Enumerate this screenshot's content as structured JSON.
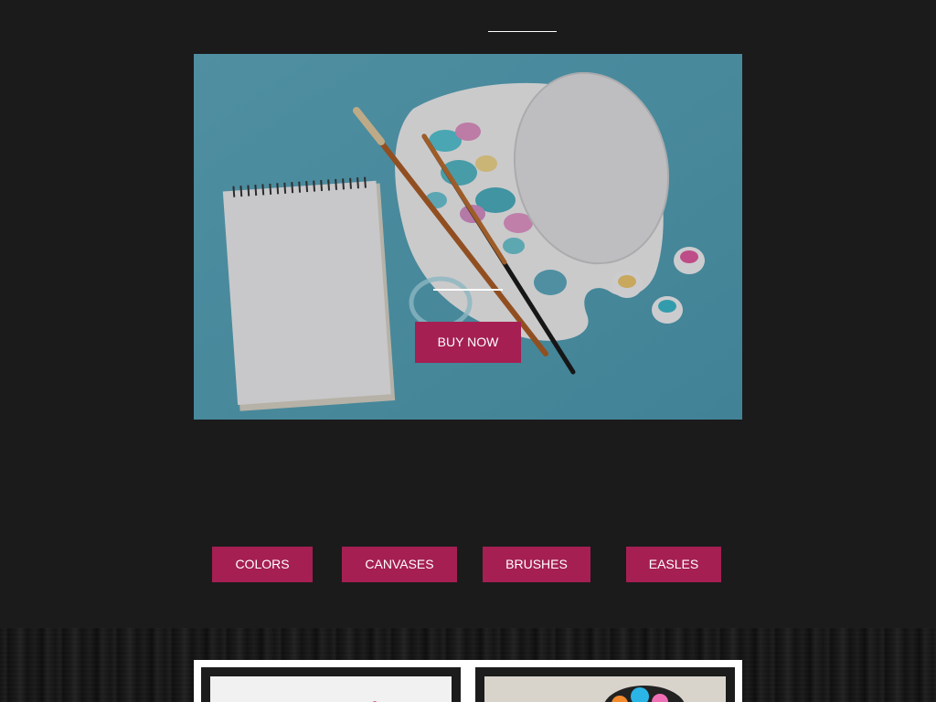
{
  "hero": {
    "buy_label": "BUY NOW",
    "image_description": "art-supplies-flatlay"
  },
  "categories": [
    {
      "label": "COLORS"
    },
    {
      "label": "CANVASES"
    },
    {
      "label": "BRUSHES"
    },
    {
      "label": "EASLES"
    }
  ],
  "colors": {
    "background": "#1b1b1c",
    "accent": "#a51f52",
    "hero_bg": "#6ab0c4",
    "divider": "#ffffff"
  }
}
